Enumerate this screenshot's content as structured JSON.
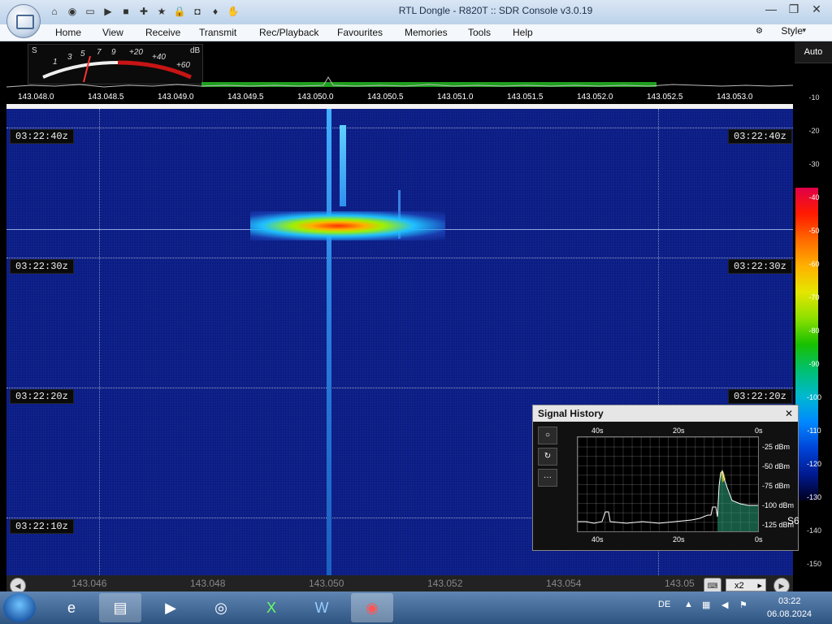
{
  "window": {
    "title": "RTL Dongle - R820T :: SDR Console v3.0.19",
    "controls": [
      "—",
      "❐",
      "✕"
    ]
  },
  "menu": {
    "items": [
      "Home",
      "View",
      "Receive",
      "Transmit",
      "Rec/Playback",
      "Favourites",
      "Memories",
      "Tools",
      "Help"
    ],
    "style_label": "Style"
  },
  "meter": {
    "s_label": "S",
    "db_label": "dB",
    "scale": [
      "1",
      "3",
      "5",
      "7",
      "9",
      "+20",
      "+40",
      "+60"
    ]
  },
  "spectrum": {
    "freq_ticks": [
      "143.048.0",
      "143.048.5",
      "143.049.0",
      "143.049.5",
      "143.050.0",
      "143.050.5",
      "143.051.0",
      "143.051.5",
      "143.052.0",
      "143.052.5",
      "143.053.0"
    ]
  },
  "level_scale": {
    "auto_label": "Auto",
    "ticks": [
      "-10",
      "-20",
      "-30",
      "-40",
      "-50",
      "-60",
      "-70",
      "-80",
      "-90",
      "-100",
      "-110",
      "-120",
      "-130",
      "-140",
      "-150"
    ]
  },
  "waterfall": {
    "timestamps": [
      "03:22:40z",
      "03:22:30z",
      "03:22:20z",
      "03:22:10z"
    ]
  },
  "bottom_scale": {
    "ticks": [
      "143.046",
      "143.048",
      "143.050",
      "143.052",
      "143.054",
      "143.05"
    ],
    "zoom_label": "x2"
  },
  "signal_history": {
    "title": "Signal History",
    "close": "✕",
    "time_labels": [
      "40s",
      "20s",
      "0s"
    ],
    "db_labels": [
      "-25 dBm",
      "-50 dBm",
      "-75 dBm",
      "-100 dBm",
      "-125 dBm"
    ],
    "current_level": "S6",
    "side_buttons": [
      "○",
      "↻",
      "···"
    ]
  },
  "taskbar": {
    "language": "DE",
    "time": "03:22",
    "date": "06.08.2024"
  },
  "colors": {
    "waterfall_bg": "#0a1a7a",
    "spectrum_green": "#1fa01f",
    "meter_red": "#c81414"
  }
}
